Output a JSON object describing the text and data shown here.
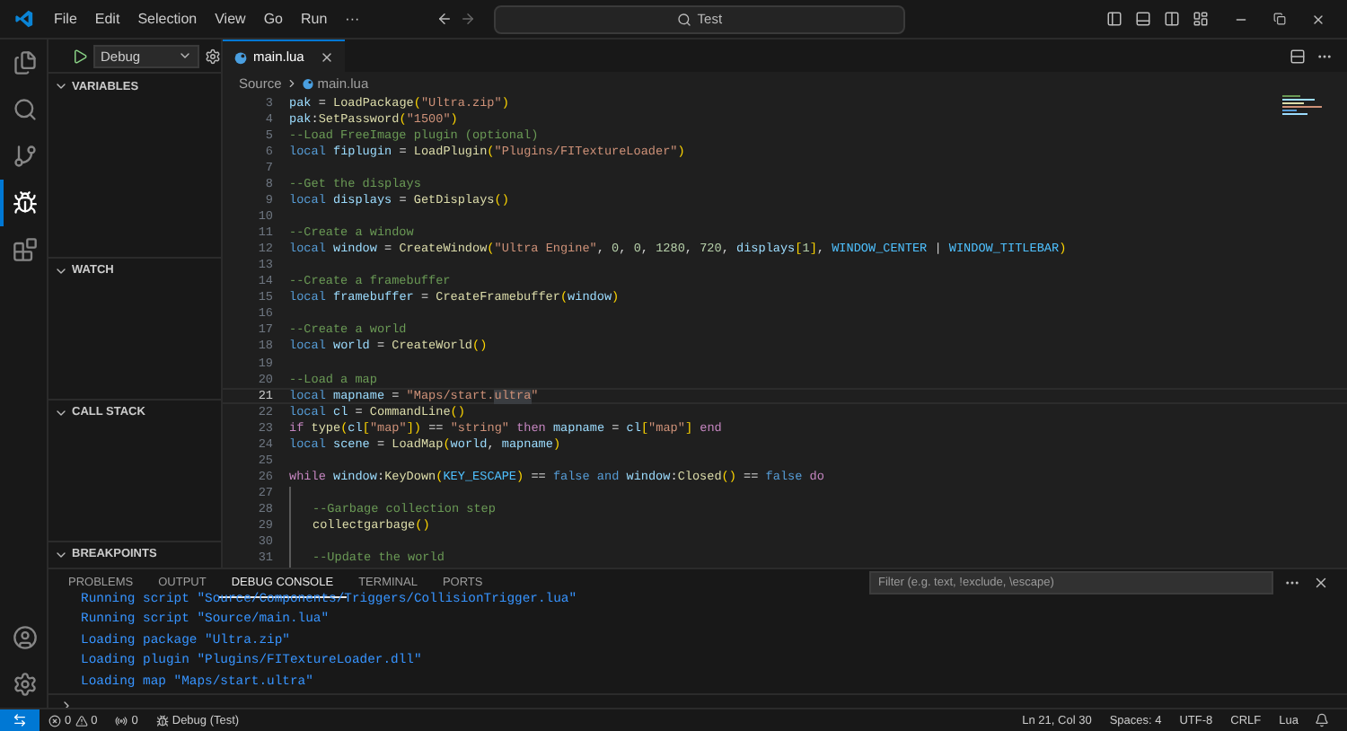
{
  "title_bar": {
    "menu": [
      "File",
      "Edit",
      "Selection",
      "View",
      "Go",
      "Run",
      "···"
    ],
    "search": "Test"
  },
  "activity_bar": [
    {
      "kind": "files",
      "selected": false
    },
    {
      "kind": "search",
      "selected": false
    },
    {
      "kind": "source-control",
      "selected": false
    },
    {
      "kind": "run",
      "selected": true
    },
    {
      "kind": "extensions",
      "selected": false
    }
  ],
  "debug_toolbar": {
    "configuration": "Debug"
  },
  "sidebar": {
    "sections": [
      {
        "title": "VARIABLES",
        "expanded": true
      },
      {
        "title": "WATCH",
        "expanded": true
      },
      {
        "title": "CALL STACK",
        "expanded": true
      },
      {
        "title": "BREAKPOINTS",
        "expanded": true
      }
    ]
  },
  "editor": {
    "tabs": [
      {
        "label": "main.lua",
        "selected": true
      }
    ],
    "breadcrumb": [
      "Source",
      "main.lua"
    ],
    "lines": [
      {
        "number": "3",
        "current": false,
        "indented": false,
        "tokens": [
          {
            "kind": "variable",
            "text": "pak"
          },
          {
            "kind": "plain",
            "text": " = "
          },
          {
            "kind": "function",
            "text": "LoadPackage"
          },
          {
            "kind": "bracket",
            "text": "("
          },
          {
            "kind": "string",
            "text": "\"Ultra.zip\""
          },
          {
            "kind": "bracket",
            "text": ")"
          }
        ]
      },
      {
        "number": "4",
        "current": false,
        "indented": false,
        "tokens": [
          {
            "kind": "variable",
            "text": "pak"
          },
          {
            "kind": "plain",
            "text": ":"
          },
          {
            "kind": "function",
            "text": "SetPassword"
          },
          {
            "kind": "bracket",
            "text": "("
          },
          {
            "kind": "string",
            "text": "\"1500\""
          },
          {
            "kind": "bracket",
            "text": ")"
          }
        ]
      },
      {
        "number": "5",
        "current": false,
        "indented": false,
        "tokens": [
          {
            "kind": "comment",
            "text": "--Load FreeImage plugin (optional)"
          }
        ]
      },
      {
        "number": "6",
        "current": false,
        "indented": false,
        "tokens": [
          {
            "kind": "keyword",
            "text": "local "
          },
          {
            "kind": "variable",
            "text": "fiplugin"
          },
          {
            "kind": "plain",
            "text": " = "
          },
          {
            "kind": "function",
            "text": "LoadPlugin"
          },
          {
            "kind": "bracket",
            "text": "("
          },
          {
            "kind": "string",
            "text": "\"Plugins/FITextureLoader\""
          },
          {
            "kind": "bracket",
            "text": ")"
          }
        ]
      },
      {
        "number": "7",
        "current": false,
        "indented": false
      },
      {
        "number": "8",
        "current": false,
        "indented": false,
        "tokens": [
          {
            "kind": "comment",
            "text": "--Get the displays"
          }
        ]
      },
      {
        "number": "9",
        "current": false,
        "indented": false,
        "tokens": [
          {
            "kind": "keyword",
            "text": "local "
          },
          {
            "kind": "variable",
            "text": "displays"
          },
          {
            "kind": "plain",
            "text": " = "
          },
          {
            "kind": "function",
            "text": "GetDisplays"
          },
          {
            "kind": "bracket",
            "text": "()"
          }
        ]
      },
      {
        "number": "10",
        "current": false,
        "indented": false
      },
      {
        "number": "11",
        "current": false,
        "indented": false,
        "tokens": [
          {
            "kind": "comment",
            "text": "--Create a window"
          }
        ]
      },
      {
        "number": "12",
        "current": false,
        "indented": false,
        "tokens": [
          {
            "kind": "keyword",
            "text": "local "
          },
          {
            "kind": "variable",
            "text": "window"
          },
          {
            "kind": "plain",
            "text": " = "
          },
          {
            "kind": "function",
            "text": "CreateWindow"
          },
          {
            "kind": "bracket",
            "text": "("
          },
          {
            "kind": "string",
            "text": "\"Ultra Engine\""
          },
          {
            "kind": "plain",
            "text": ", "
          },
          {
            "kind": "number",
            "text": "0"
          },
          {
            "kind": "plain",
            "text": ", "
          },
          {
            "kind": "number",
            "text": "0"
          },
          {
            "kind": "plain",
            "text": ", "
          },
          {
            "kind": "number",
            "text": "1280"
          },
          {
            "kind": "plain",
            "text": ", "
          },
          {
            "kind": "number",
            "text": "720"
          },
          {
            "kind": "plain",
            "text": ", "
          },
          {
            "kind": "variable",
            "text": "displays"
          },
          {
            "kind": "bracket",
            "text": "["
          },
          {
            "kind": "number",
            "text": "1"
          },
          {
            "kind": "bracket",
            "text": "]"
          },
          {
            "kind": "plain",
            "text": ", "
          },
          {
            "kind": "constant",
            "text": "WINDOW_CENTER"
          },
          {
            "kind": "plain",
            "text": " | "
          },
          {
            "kind": "constant",
            "text": "WINDOW_TITLEBAR"
          },
          {
            "kind": "bracket",
            "text": ")"
          }
        ]
      },
      {
        "number": "13",
        "current": false,
        "indented": false
      },
      {
        "number": "14",
        "current": false,
        "indented": false,
        "tokens": [
          {
            "kind": "comment",
            "text": "--Create a framebuffer"
          }
        ]
      },
      {
        "number": "15",
        "current": false,
        "indented": false,
        "tokens": [
          {
            "kind": "keyword",
            "text": "local "
          },
          {
            "kind": "variable",
            "text": "framebuffer"
          },
          {
            "kind": "plain",
            "text": " = "
          },
          {
            "kind": "function",
            "text": "CreateFramebuffer"
          },
          {
            "kind": "bracket",
            "text": "("
          },
          {
            "kind": "variable",
            "text": "window"
          },
          {
            "kind": "bracket",
            "text": ")"
          }
        ]
      },
      {
        "number": "16",
        "current": false,
        "indented": false
      },
      {
        "number": "17",
        "current": false,
        "indented": false,
        "tokens": [
          {
            "kind": "comment",
            "text": "--Create a world"
          }
        ]
      },
      {
        "number": "18",
        "current": false,
        "indented": false,
        "tokens": [
          {
            "kind": "keyword",
            "text": "local "
          },
          {
            "kind": "variable",
            "text": "world"
          },
          {
            "kind": "plain",
            "text": " = "
          },
          {
            "kind": "function",
            "text": "CreateWorld"
          },
          {
            "kind": "bracket",
            "text": "()"
          }
        ]
      },
      {
        "number": "19",
        "current": false,
        "indented": false
      },
      {
        "number": "20",
        "current": false,
        "indented": false,
        "tokens": [
          {
            "kind": "comment",
            "text": "--Load a map"
          }
        ]
      },
      {
        "number": "21",
        "current": true,
        "indented": false,
        "tokens": [
          {
            "kind": "keyword",
            "text": "local "
          },
          {
            "kind": "variable",
            "text": "mapname"
          },
          {
            "kind": "plain",
            "text": " = "
          },
          {
            "kind": "string",
            "text": "\"Maps/start."
          },
          {
            "kind": "match",
            "text": "ultra"
          },
          {
            "kind": "string",
            "text": "\""
          }
        ]
      },
      {
        "number": "22",
        "current": false,
        "indented": false,
        "tokens": [
          {
            "kind": "keyword",
            "text": "local "
          },
          {
            "kind": "variable",
            "text": "cl"
          },
          {
            "kind": "plain",
            "text": " = "
          },
          {
            "kind": "function",
            "text": "CommandLine"
          },
          {
            "kind": "bracket",
            "text": "()"
          }
        ]
      },
      {
        "number": "23",
        "current": false,
        "indented": false,
        "tokens": [
          {
            "kind": "control",
            "text": "if "
          },
          {
            "kind": "function",
            "text": "type"
          },
          {
            "kind": "bracket",
            "text": "("
          },
          {
            "kind": "variable",
            "text": "cl"
          },
          {
            "kind": "bracket",
            "text": "["
          },
          {
            "kind": "string",
            "text": "\"map\""
          },
          {
            "kind": "bracket",
            "text": "])"
          },
          {
            "kind": "plain",
            "text": " == "
          },
          {
            "kind": "string",
            "text": "\"string\" "
          },
          {
            "kind": "control",
            "text": "then "
          },
          {
            "kind": "variable",
            "text": "mapname"
          },
          {
            "kind": "plain",
            "text": " = "
          },
          {
            "kind": "variable",
            "text": "cl"
          },
          {
            "kind": "bracket",
            "text": "["
          },
          {
            "kind": "string",
            "text": "\"map\""
          },
          {
            "kind": "bracket",
            "text": "] "
          },
          {
            "kind": "control",
            "text": "end"
          }
        ]
      },
      {
        "number": "24",
        "current": false,
        "indented": false,
        "tokens": [
          {
            "kind": "keyword",
            "text": "local "
          },
          {
            "kind": "variable",
            "text": "scene"
          },
          {
            "kind": "plain",
            "text": " = "
          },
          {
            "kind": "function",
            "text": "LoadMap"
          },
          {
            "kind": "bracket",
            "text": "("
          },
          {
            "kind": "variable",
            "text": "world"
          },
          {
            "kind": "plain",
            "text": ", "
          },
          {
            "kind": "variable",
            "text": "mapname"
          },
          {
            "kind": "bracket",
            "text": ")"
          }
        ]
      },
      {
        "number": "25",
        "current": false,
        "indented": false
      },
      {
        "number": "26",
        "current": false,
        "indented": false,
        "tokens": [
          {
            "kind": "control",
            "text": "while "
          },
          {
            "kind": "variable",
            "text": "window"
          },
          {
            "kind": "plain",
            "text": ":"
          },
          {
            "kind": "function",
            "text": "KeyDown"
          },
          {
            "kind": "bracket",
            "text": "("
          },
          {
            "kind": "constant",
            "text": "KEY_ESCAPE"
          },
          {
            "kind": "bracket",
            "text": ")"
          },
          {
            "kind": "plain",
            "text": " == "
          },
          {
            "kind": "keyword",
            "text": "false and "
          },
          {
            "kind": "variable",
            "text": "window"
          },
          {
            "kind": "plain",
            "text": ":"
          },
          {
            "kind": "function",
            "text": "Closed"
          },
          {
            "kind": "bracket",
            "text": "()"
          },
          {
            "kind": "plain",
            "text": " == "
          },
          {
            "kind": "keyword",
            "text": "false "
          },
          {
            "kind": "control",
            "text": "do"
          }
        ]
      },
      {
        "number": "27",
        "current": false,
        "indented": true
      },
      {
        "number": "28",
        "current": false,
        "indented": true,
        "tokens": [
          {
            "kind": "comment",
            "text": "--Garbage collection step"
          }
        ]
      },
      {
        "number": "29",
        "current": false,
        "indented": true,
        "tokens": [
          {
            "kind": "function",
            "text": "collectgarbage"
          },
          {
            "kind": "bracket",
            "text": "()"
          }
        ]
      },
      {
        "number": "30",
        "current": false,
        "indented": true
      },
      {
        "number": "31",
        "current": false,
        "indented": true,
        "tokens": [
          {
            "kind": "comment",
            "text": "--Update the world"
          }
        ]
      }
    ]
  },
  "panel": {
    "tabs": [
      {
        "label": "PROBLEMS",
        "selected": false
      },
      {
        "label": "OUTPUT",
        "selected": false
      },
      {
        "label": "DEBUG CONSOLE",
        "selected": true
      },
      {
        "label": "TERMINAL",
        "selected": false
      },
      {
        "label": "PORTS",
        "selected": false
      }
    ],
    "filter": {
      "placeholder": "Filter (e.g. text, !exclude, \\escape)"
    },
    "console_lines": [
      "Running script \"Source/Components/Triggers/CollisionTrigger.lua\"",
      "Running script \"Source/main.lua\"",
      "Loading package \"Ultra.zip\"",
      "Loading plugin \"Plugins/FITextureLoader.dll\"",
      "Loading map \"Maps/start.ultra\""
    ]
  },
  "status_bar": {
    "errors": "0",
    "warnings": "0",
    "ports": "0",
    "debug": "Debug (Test)",
    "position": "Ln 21, Col 30",
    "indent": "Spaces: 4",
    "encoding": "UTF-8",
    "eol": "CRLF",
    "language": "Lua"
  }
}
